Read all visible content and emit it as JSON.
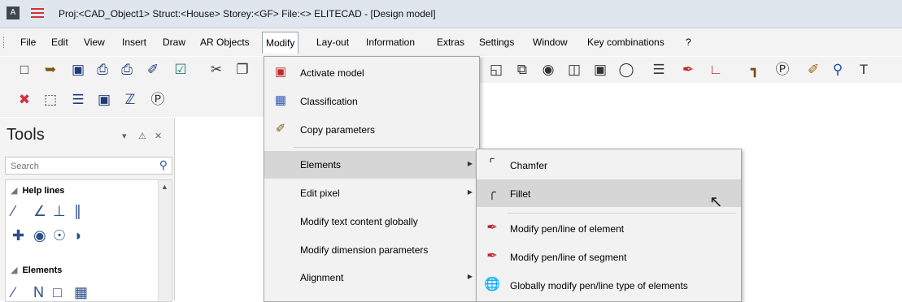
{
  "window": {
    "title": "Proj:<CAD_Object1> Struct:<House> Storey:<GF> File:<> ELITECAD - [Design model]",
    "app_icon_text": "A"
  },
  "menubar": {
    "items": [
      "File",
      "Edit",
      "View",
      "Insert",
      "Draw",
      "AR Objects",
      "Modify",
      "Lay-out",
      "Information",
      "Extras",
      "Settings",
      "Window",
      "Key combinations",
      "?"
    ],
    "active": "Modify"
  },
  "toolbar1": {
    "icons": [
      "new-icon",
      "open-icon",
      "save-icon",
      "print-icon",
      "print-preview-icon",
      "plot-icon",
      "export-icon",
      "cut-icon",
      "copy-icon"
    ],
    "right_icons": [
      "copy-object-icon",
      "duplicate-icon",
      "rotate-icon",
      "mirror-icon",
      "scale-icon",
      "group-icon",
      "align-icon",
      "edit-pen-icon",
      "line-type-icon",
      "stairs-icon",
      "pin-icon",
      "brush-icon",
      "zoom-icon",
      "text-tool-icon"
    ]
  },
  "toolbar2": {
    "icons": [
      "stop-icon",
      "select-icon",
      "layers-icon",
      "window-icon",
      "model-icon",
      "pointer-p-icon"
    ]
  },
  "tools_panel": {
    "title": "Tools",
    "search": {
      "placeholder": "Search",
      "value": ""
    },
    "groups": [
      {
        "label": "Help lines"
      },
      {
        "label": "Elements"
      }
    ]
  },
  "modify_menu": {
    "items": [
      {
        "label": "Activate model",
        "icon": "activate-model-icon",
        "has_submenu": false
      },
      {
        "label": "Classification",
        "icon": "classification-icon",
        "has_submenu": false
      },
      {
        "label": "Copy parameters",
        "icon": "copy-parameters-icon",
        "has_submenu": false
      },
      {
        "label": "Elements",
        "icon": "",
        "has_submenu": true,
        "highlighted": true
      },
      {
        "label": "Edit pixel",
        "icon": "",
        "has_submenu": true
      },
      {
        "label": "Modify text content globally",
        "icon": "",
        "has_submenu": false
      },
      {
        "label": "Modify dimension parameters",
        "icon": "",
        "has_submenu": false
      },
      {
        "label": "Alignment",
        "icon": "",
        "has_submenu": true
      }
    ]
  },
  "elements_submenu": {
    "items": [
      {
        "label": "Chamfer",
        "icon": "chamfer-icon"
      },
      {
        "label": "Fillet",
        "icon": "fillet-icon",
        "highlighted": true
      },
      {
        "label": "Modify pen/line of element",
        "icon": "modify-pen-element-icon"
      },
      {
        "label": "Modify pen/line of segment",
        "icon": "modify-pen-segment-icon"
      },
      {
        "label": "Globally modify pen/line type of elements",
        "icon": "global-modify-pen-icon"
      }
    ]
  },
  "colors": {
    "title_bg": "#dfe6ee",
    "menu_bg": "#f2f2f2",
    "highlight": "#d6d6d6",
    "accent_red": "#d0343d"
  }
}
